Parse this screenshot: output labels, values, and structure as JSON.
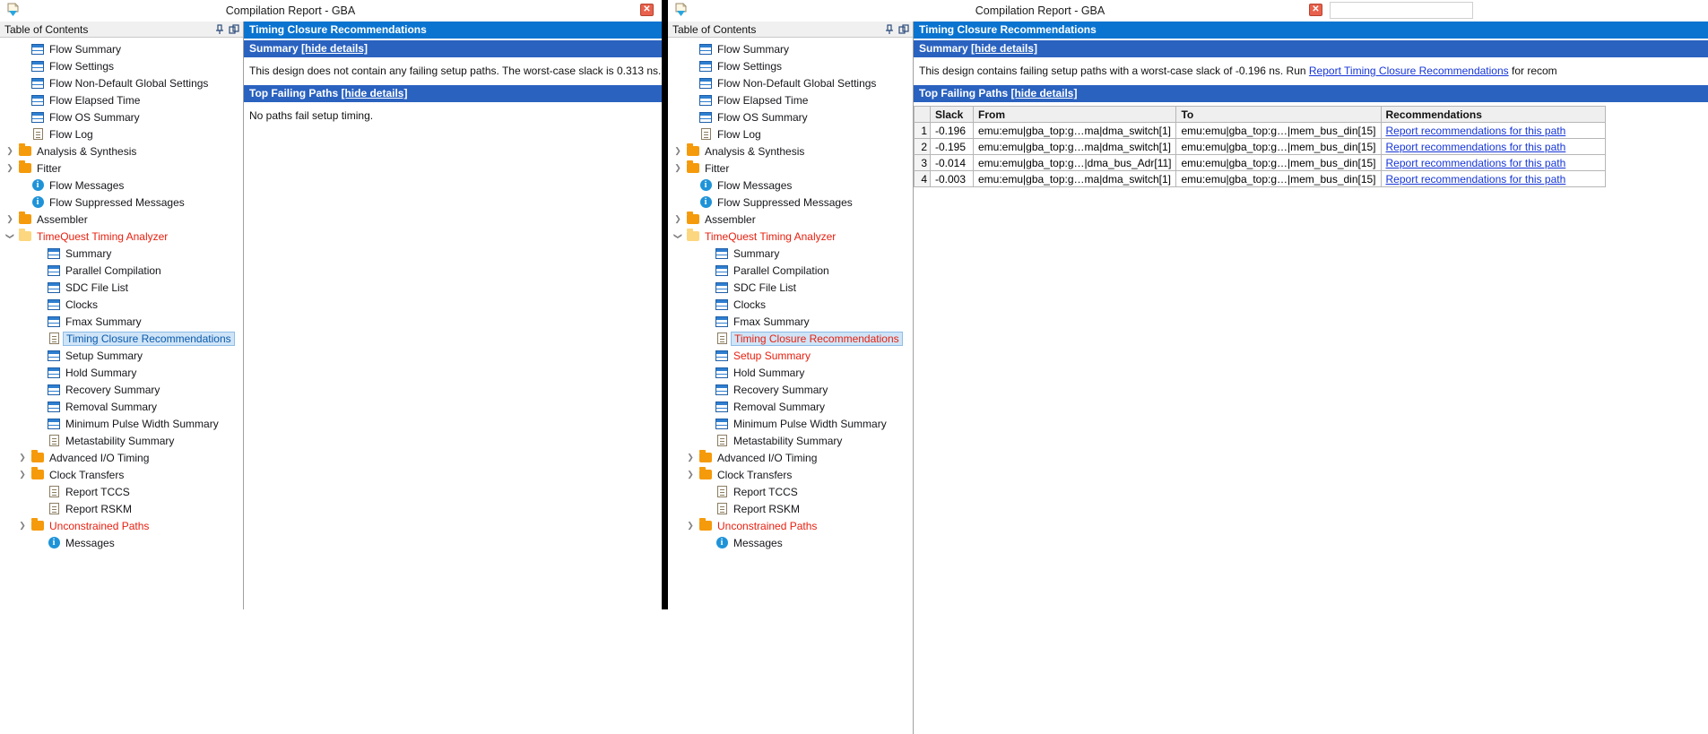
{
  "windows": [
    {
      "title": "Compilation Report - GBA",
      "close_label": "✕",
      "toc": {
        "header": "Table of Contents",
        "pin_icon": "pin-icon",
        "undock_icon": "undock-icon",
        "items": [
          {
            "label": "Flow Summary",
            "icon": "table-icon",
            "level": 1,
            "arrow": "",
            "red": false,
            "selected": false
          },
          {
            "label": "Flow Settings",
            "icon": "table-icon",
            "level": 1,
            "arrow": "",
            "red": false,
            "selected": false
          },
          {
            "label": "Flow Non-Default Global Settings",
            "icon": "table-icon",
            "level": 1,
            "arrow": "",
            "red": false,
            "selected": false
          },
          {
            "label": "Flow Elapsed Time",
            "icon": "table-icon",
            "level": 1,
            "arrow": "",
            "red": false,
            "selected": false
          },
          {
            "label": "Flow OS Summary",
            "icon": "table-icon",
            "level": 1,
            "arrow": "",
            "red": false,
            "selected": false
          },
          {
            "label": "Flow Log",
            "icon": "document-icon",
            "level": 1,
            "arrow": "",
            "red": false,
            "selected": false
          },
          {
            "label": "Analysis & Synthesis",
            "icon": "folder-icon",
            "level": 0,
            "arrow": "collapsed",
            "red": false,
            "selected": false
          },
          {
            "label": "Fitter",
            "icon": "folder-icon",
            "level": 0,
            "arrow": "collapsed",
            "red": false,
            "selected": false
          },
          {
            "label": "Flow Messages",
            "icon": "info-icon",
            "level": 1,
            "arrow": "",
            "red": false,
            "selected": false
          },
          {
            "label": "Flow Suppressed Messages",
            "icon": "info-icon",
            "level": 1,
            "arrow": "",
            "red": false,
            "selected": false
          },
          {
            "label": "Assembler",
            "icon": "folder-icon",
            "level": 0,
            "arrow": "collapsed",
            "red": false,
            "selected": false
          },
          {
            "label": "TimeQuest Timing Analyzer",
            "icon": "folder-open-icon",
            "level": 0,
            "arrow": "expanded",
            "red": true,
            "selected": false
          },
          {
            "label": "Summary",
            "icon": "table-icon",
            "level": 2,
            "arrow": "",
            "red": false,
            "selected": false
          },
          {
            "label": "Parallel Compilation",
            "icon": "table-icon",
            "level": 2,
            "arrow": "",
            "red": false,
            "selected": false
          },
          {
            "label": "SDC File List",
            "icon": "table-icon",
            "level": 2,
            "arrow": "",
            "red": false,
            "selected": false
          },
          {
            "label": "Clocks",
            "icon": "table-icon",
            "level": 2,
            "arrow": "",
            "red": false,
            "selected": false
          },
          {
            "label": "Fmax Summary",
            "icon": "table-icon",
            "level": 2,
            "arrow": "",
            "red": false,
            "selected": false
          },
          {
            "label": "Timing Closure Recommendations",
            "icon": "document-icon",
            "level": 2,
            "arrow": "",
            "red": false,
            "selected": true
          },
          {
            "label": "Setup Summary",
            "icon": "table-icon",
            "level": 2,
            "arrow": "",
            "red": false,
            "selected": false
          },
          {
            "label": "Hold Summary",
            "icon": "table-icon",
            "level": 2,
            "arrow": "",
            "red": false,
            "selected": false
          },
          {
            "label": "Recovery Summary",
            "icon": "table-icon",
            "level": 2,
            "arrow": "",
            "red": false,
            "selected": false
          },
          {
            "label": "Removal Summary",
            "icon": "table-icon",
            "level": 2,
            "arrow": "",
            "red": false,
            "selected": false
          },
          {
            "label": "Minimum Pulse Width Summary",
            "icon": "table-icon",
            "level": 2,
            "arrow": "",
            "red": false,
            "selected": false
          },
          {
            "label": "Metastability Summary",
            "icon": "document-icon",
            "level": 2,
            "arrow": "",
            "red": false,
            "selected": false
          },
          {
            "label": "Advanced I/O Timing",
            "icon": "folder-icon",
            "level": 1,
            "arrow": "collapsed",
            "red": false,
            "selected": false
          },
          {
            "label": "Clock Transfers",
            "icon": "folder-icon",
            "level": 1,
            "arrow": "collapsed",
            "red": false,
            "selected": false
          },
          {
            "label": "Report TCCS",
            "icon": "document-icon",
            "level": 2,
            "arrow": "",
            "red": false,
            "selected": false
          },
          {
            "label": "Report RSKM",
            "icon": "document-icon",
            "level": 2,
            "arrow": "",
            "red": false,
            "selected": false
          },
          {
            "label": "Unconstrained Paths",
            "icon": "folder-icon",
            "level": 1,
            "arrow": "collapsed",
            "red": true,
            "selected": false
          },
          {
            "label": "Messages",
            "icon": "info-icon",
            "level": 2,
            "arrow": "",
            "red": false,
            "selected": false
          }
        ]
      },
      "report": {
        "title": "Timing Closure Recommendations",
        "summary_label": "Summary",
        "summary_hide": "[hide details]",
        "summary_text": "This design does not contain any failing setup paths. The worst-case slack is 0.313 ns.",
        "paths_label": "Top Failing Paths",
        "paths_hide": "[hide details]",
        "paths_text": "No paths fail setup timing.",
        "has_table": false
      }
    },
    {
      "title": "Compilation Report - GBA",
      "close_label": "✕",
      "toc": {
        "header": "Table of Contents",
        "pin_icon": "pin-icon",
        "undock_icon": "undock-icon",
        "items": [
          {
            "label": "Flow Summary",
            "icon": "table-icon",
            "level": 1,
            "arrow": "",
            "red": false,
            "selected": false
          },
          {
            "label": "Flow Settings",
            "icon": "table-icon",
            "level": 1,
            "arrow": "",
            "red": false,
            "selected": false
          },
          {
            "label": "Flow Non-Default Global Settings",
            "icon": "table-icon",
            "level": 1,
            "arrow": "",
            "red": false,
            "selected": false
          },
          {
            "label": "Flow Elapsed Time",
            "icon": "table-icon",
            "level": 1,
            "arrow": "",
            "red": false,
            "selected": false
          },
          {
            "label": "Flow OS Summary",
            "icon": "table-icon",
            "level": 1,
            "arrow": "",
            "red": false,
            "selected": false
          },
          {
            "label": "Flow Log",
            "icon": "document-icon",
            "level": 1,
            "arrow": "",
            "red": false,
            "selected": false
          },
          {
            "label": "Analysis & Synthesis",
            "icon": "folder-icon",
            "level": 0,
            "arrow": "collapsed",
            "red": false,
            "selected": false
          },
          {
            "label": "Fitter",
            "icon": "folder-icon",
            "level": 0,
            "arrow": "collapsed",
            "red": false,
            "selected": false
          },
          {
            "label": "Flow Messages",
            "icon": "info-icon",
            "level": 1,
            "arrow": "",
            "red": false,
            "selected": false
          },
          {
            "label": "Flow Suppressed Messages",
            "icon": "info-icon",
            "level": 1,
            "arrow": "",
            "red": false,
            "selected": false
          },
          {
            "label": "Assembler",
            "icon": "folder-icon",
            "level": 0,
            "arrow": "collapsed",
            "red": false,
            "selected": false
          },
          {
            "label": "TimeQuest Timing Analyzer",
            "icon": "folder-open-icon",
            "level": 0,
            "arrow": "expanded",
            "red": true,
            "selected": false
          },
          {
            "label": "Summary",
            "icon": "table-icon",
            "level": 2,
            "arrow": "",
            "red": false,
            "selected": false
          },
          {
            "label": "Parallel Compilation",
            "icon": "table-icon",
            "level": 2,
            "arrow": "",
            "red": false,
            "selected": false
          },
          {
            "label": "SDC File List",
            "icon": "table-icon",
            "level": 2,
            "arrow": "",
            "red": false,
            "selected": false
          },
          {
            "label": "Clocks",
            "icon": "table-icon",
            "level": 2,
            "arrow": "",
            "red": false,
            "selected": false
          },
          {
            "label": "Fmax Summary",
            "icon": "table-icon",
            "level": 2,
            "arrow": "",
            "red": false,
            "selected": false
          },
          {
            "label": "Timing Closure Recommendations",
            "icon": "document-icon",
            "level": 2,
            "arrow": "",
            "red": true,
            "selected": true
          },
          {
            "label": "Setup Summary",
            "icon": "table-icon",
            "level": 2,
            "arrow": "",
            "red": true,
            "selected": false
          },
          {
            "label": "Hold Summary",
            "icon": "table-icon",
            "level": 2,
            "arrow": "",
            "red": false,
            "selected": false
          },
          {
            "label": "Recovery Summary",
            "icon": "table-icon",
            "level": 2,
            "arrow": "",
            "red": false,
            "selected": false
          },
          {
            "label": "Removal Summary",
            "icon": "table-icon",
            "level": 2,
            "arrow": "",
            "red": false,
            "selected": false
          },
          {
            "label": "Minimum Pulse Width Summary",
            "icon": "table-icon",
            "level": 2,
            "arrow": "",
            "red": false,
            "selected": false
          },
          {
            "label": "Metastability Summary",
            "icon": "document-icon",
            "level": 2,
            "arrow": "",
            "red": false,
            "selected": false
          },
          {
            "label": "Advanced I/O Timing",
            "icon": "folder-icon",
            "level": 1,
            "arrow": "collapsed",
            "red": false,
            "selected": false
          },
          {
            "label": "Clock Transfers",
            "icon": "folder-icon",
            "level": 1,
            "arrow": "collapsed",
            "red": false,
            "selected": false
          },
          {
            "label": "Report TCCS",
            "icon": "document-icon",
            "level": 2,
            "arrow": "",
            "red": false,
            "selected": false
          },
          {
            "label": "Report RSKM",
            "icon": "document-icon",
            "level": 2,
            "arrow": "",
            "red": false,
            "selected": false
          },
          {
            "label": "Unconstrained Paths",
            "icon": "folder-icon",
            "level": 1,
            "arrow": "collapsed",
            "red": true,
            "selected": false
          },
          {
            "label": "Messages",
            "icon": "info-icon",
            "level": 2,
            "arrow": "",
            "red": false,
            "selected": false
          }
        ]
      },
      "report": {
        "title": "Timing Closure Recommendations",
        "summary_label": "Summary",
        "summary_hide": "[hide details]",
        "summary_text_pre": "This design contains failing setup paths with a worst-case slack of -0.196 ns. Run ",
        "summary_link": "Report Timing Closure Recommendations",
        "summary_text_post": " for recom",
        "paths_label": "Top Failing Paths",
        "paths_hide": "[hide details]",
        "has_table": true,
        "table": {
          "columns": [
            "",
            "Slack",
            "From",
            "To",
            "Recommendations"
          ],
          "rows": [
            {
              "idx": "1",
              "slack": "-0.196",
              "from": "emu:emu|gba_top:g…ma|dma_switch[1]",
              "to": "emu:emu|gba_top:g…|mem_bus_din[15]",
              "rec": "Report recommendations for this path"
            },
            {
              "idx": "2",
              "slack": "-0.195",
              "from": "emu:emu|gba_top:g…ma|dma_switch[1]",
              "to": "emu:emu|gba_top:g…|mem_bus_din[15]",
              "rec": "Report recommendations for this path"
            },
            {
              "idx": "3",
              "slack": "-0.014",
              "from": "emu:emu|gba_top:g…|dma_bus_Adr[11]",
              "to": "emu:emu|gba_top:g…|mem_bus_din[15]",
              "rec": "Report recommendations for this path"
            },
            {
              "idx": "4",
              "slack": "-0.003",
              "from": "emu:emu|gba_top:g…ma|dma_switch[1]",
              "to": "emu:emu|gba_top:g…|mem_bus_din[15]",
              "rec": "Report recommendations for this path"
            }
          ]
        }
      }
    }
  ]
}
